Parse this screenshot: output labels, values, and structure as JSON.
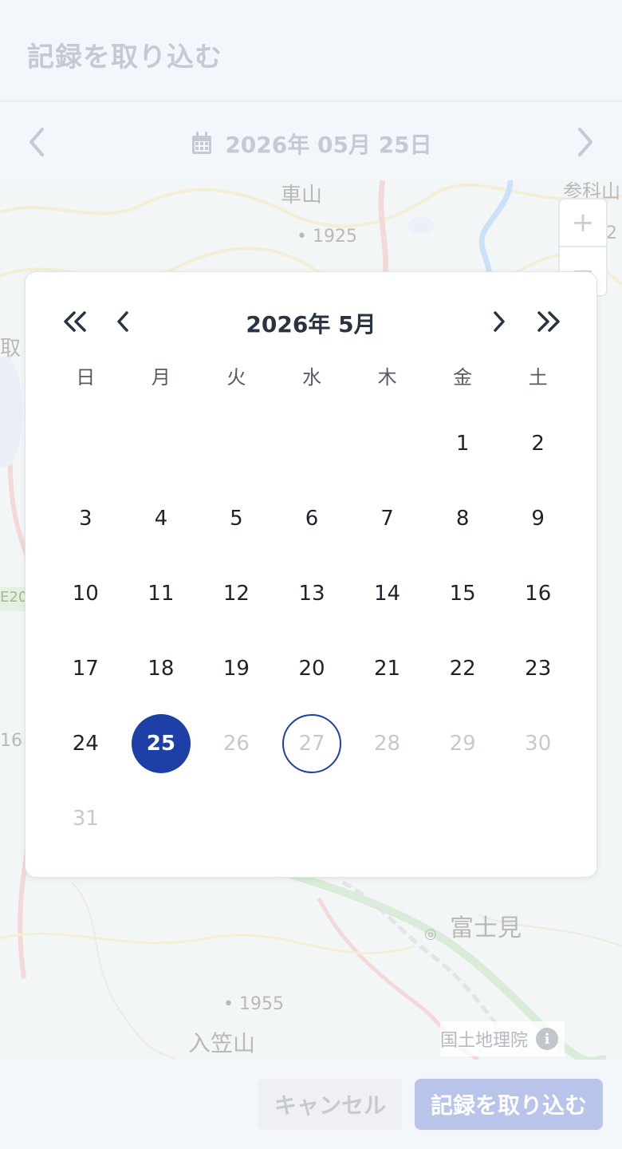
{
  "header": {
    "title": "記録を取り込む"
  },
  "date_bar": {
    "date_text": "2026年 05月 25日",
    "calendar_icon": "calendar-icon",
    "prev_icon": "chevron-left-icon",
    "next_icon": "chevron-right-icon"
  },
  "map": {
    "labels": [
      "車山",
      "1925",
      "参科山",
      "富士見",
      "1955",
      "入笠山",
      "取",
      "E20",
      "16",
      "2"
    ],
    "zoom_in": "+",
    "zoom_out": "−",
    "attribution": "国土地理院",
    "info_icon": "i"
  },
  "calendar": {
    "month_title": "2026年 5月",
    "weekdays": [
      "日",
      "月",
      "火",
      "水",
      "木",
      "金",
      "土"
    ],
    "leading_blanks": 5,
    "days": [
      {
        "d": "1",
        "s": "normal"
      },
      {
        "d": "2",
        "s": "normal"
      },
      {
        "d": "3",
        "s": "normal"
      },
      {
        "d": "4",
        "s": "normal"
      },
      {
        "d": "5",
        "s": "normal"
      },
      {
        "d": "6",
        "s": "normal"
      },
      {
        "d": "7",
        "s": "normal"
      },
      {
        "d": "8",
        "s": "normal"
      },
      {
        "d": "9",
        "s": "normal"
      },
      {
        "d": "10",
        "s": "normal"
      },
      {
        "d": "11",
        "s": "normal"
      },
      {
        "d": "12",
        "s": "normal"
      },
      {
        "d": "13",
        "s": "normal"
      },
      {
        "d": "14",
        "s": "normal"
      },
      {
        "d": "15",
        "s": "normal"
      },
      {
        "d": "16",
        "s": "normal"
      },
      {
        "d": "17",
        "s": "normal"
      },
      {
        "d": "18",
        "s": "normal"
      },
      {
        "d": "19",
        "s": "normal"
      },
      {
        "d": "20",
        "s": "normal"
      },
      {
        "d": "21",
        "s": "normal"
      },
      {
        "d": "22",
        "s": "normal"
      },
      {
        "d": "23",
        "s": "normal"
      },
      {
        "d": "24",
        "s": "normal"
      },
      {
        "d": "25",
        "s": "selected"
      },
      {
        "d": "26",
        "s": "disabled"
      },
      {
        "d": "27",
        "s": "today"
      },
      {
        "d": "28",
        "s": "disabled"
      },
      {
        "d": "29",
        "s": "disabled"
      },
      {
        "d": "30",
        "s": "disabled"
      },
      {
        "d": "31",
        "s": "disabled"
      }
    ]
  },
  "footer": {
    "cancel_label": "キャンセル",
    "import_label": "記録を取り込む"
  },
  "colors": {
    "accent": "#1d3fa6",
    "disabled_text": "#c5c9cf",
    "import_button_bg": "#b9c4ea"
  }
}
